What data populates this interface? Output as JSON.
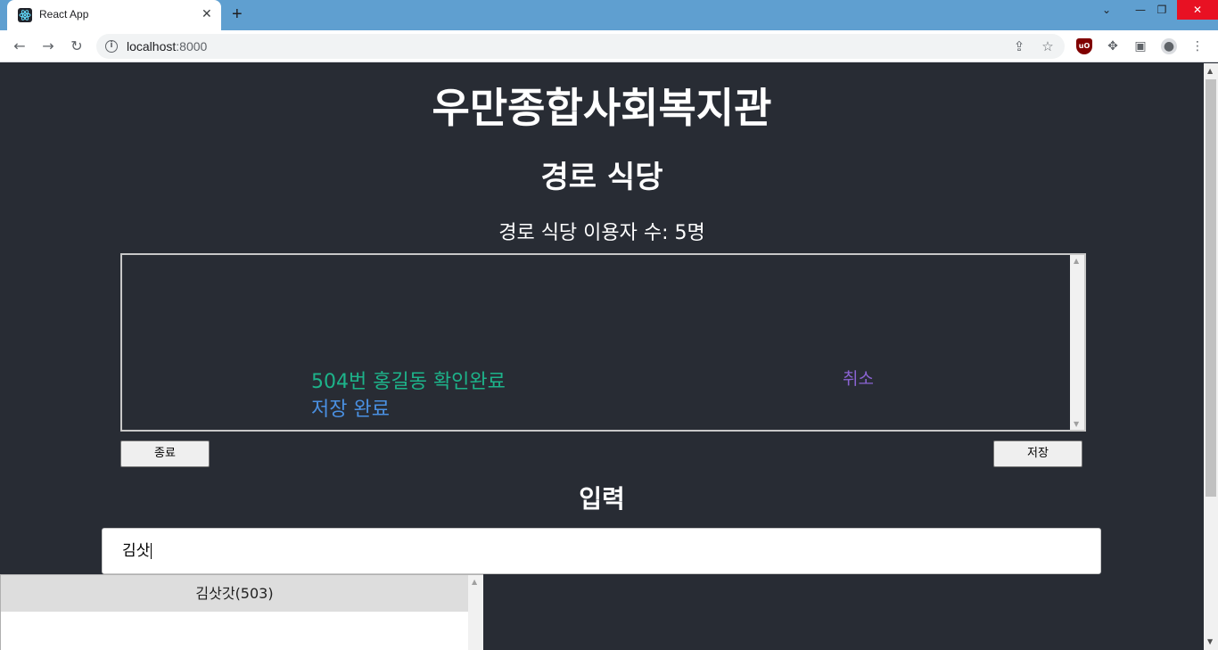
{
  "browser": {
    "tab_title": "React App",
    "tab_close": "✕",
    "new_tab": "+",
    "url_host": "localhost",
    "url_port": ":8000",
    "window_controls": [
      "⌄",
      "—",
      "❐",
      "✕"
    ]
  },
  "page": {
    "title": "우만종합사회복지관",
    "subtitle": "경로 식당",
    "user_count": "경로 식당 이용자 수: 5명",
    "log": {
      "line1": "504번 홍길동 확인완료",
      "line2": "저장 완료",
      "cancel": "취소"
    },
    "buttons": {
      "end": "종료",
      "save": "저장"
    },
    "input_heading": "입력",
    "input_value": "김삿",
    "suggestions": [
      "김삿갓(503)"
    ]
  },
  "colors": {
    "page_bg": "#282c34",
    "confirm_text": "#1db38a",
    "saved_text": "#4a90e2",
    "cancel_text": "#8a63d2"
  }
}
